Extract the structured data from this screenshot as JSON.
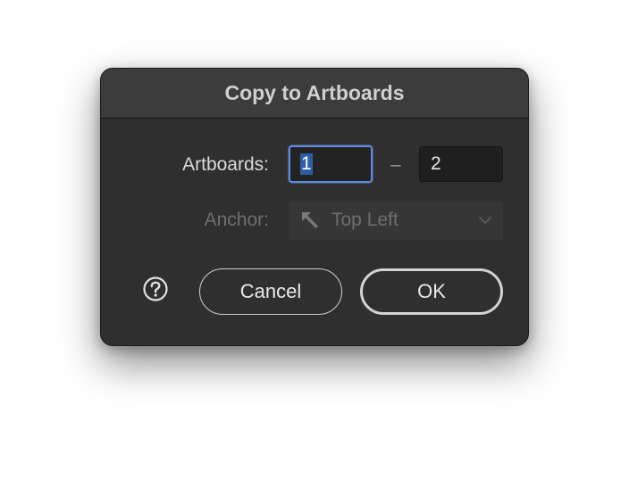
{
  "dialog": {
    "title": "Copy to Artboards",
    "artboards": {
      "label": "Artboards:",
      "from_value": "1",
      "separator": "–",
      "to_value": "2"
    },
    "anchor": {
      "label": "Anchor:",
      "selected_value": "Top Left",
      "icon": "arrow-up-left-icon",
      "enabled": false
    },
    "buttons": {
      "cancel_label": "Cancel",
      "ok_label": "OK"
    },
    "help_icon": "question-mark-circle-icon"
  },
  "colors": {
    "dialog_background": "#2f2f2f",
    "titlebar_background": "#3c3c3c",
    "focus_ring": "#5b8be0",
    "text_selection": "#2f5ea8"
  }
}
